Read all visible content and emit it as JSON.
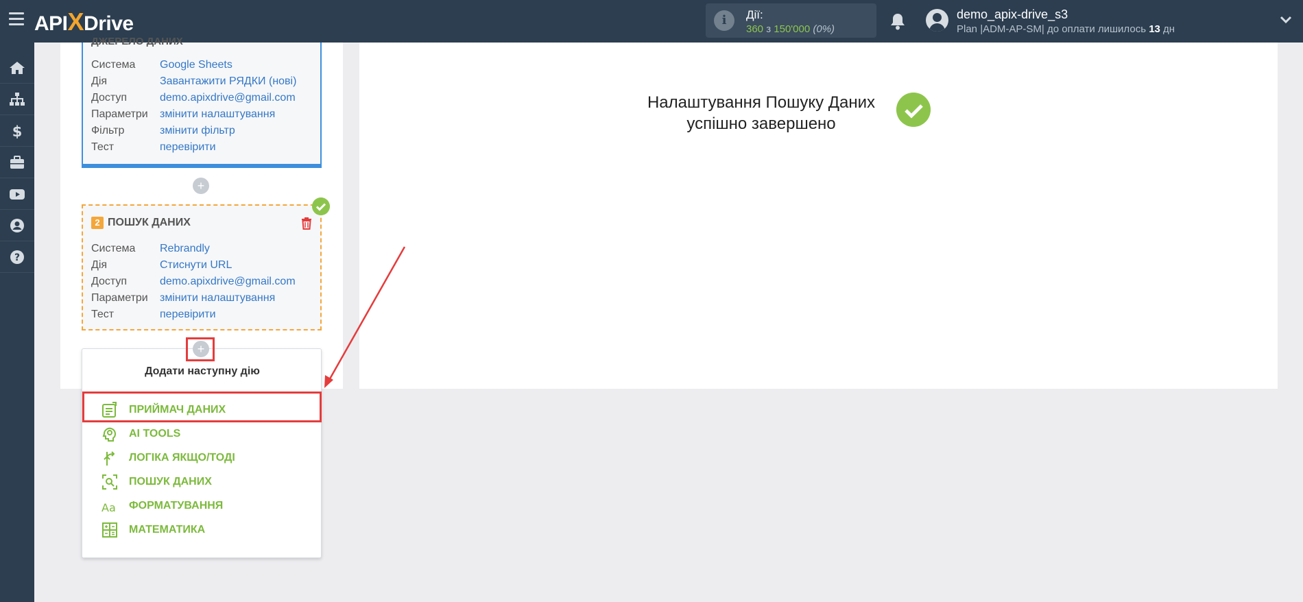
{
  "header": {
    "logo_left": "API",
    "logo_x": "X",
    "logo_right": "Drive",
    "actions_label": "Дії:",
    "actions_used": "360",
    "actions_sep": "з",
    "actions_total": "150'000",
    "actions_pct": "(0%)",
    "username": "demo_apix-drive_s3",
    "plan_text": "Plan |ADM-AP-SM| до оплати лишилось",
    "plan_days": "13",
    "plan_unit": "дн"
  },
  "sidebar": {
    "items": [
      "home-icon",
      "sitemap-icon",
      "dollar-icon",
      "briefcase-icon",
      "youtube-icon",
      "user-icon",
      "help-icon"
    ]
  },
  "block1": {
    "partial_title": "ДЖЕРЕЛО ДАНИХ",
    "rows": [
      {
        "k": "Система",
        "v": "Google Sheets"
      },
      {
        "k": "Дія",
        "v": "Завантажити РЯДКИ (нові)"
      },
      {
        "k": "Доступ",
        "v": "demo.apixdrive@gmail.com"
      },
      {
        "k": "Параметри",
        "v": "змінити налаштування"
      },
      {
        "k": "Фільтр",
        "v": "змінити фільтр"
      },
      {
        "k": "Тест",
        "v": "перевірити"
      }
    ]
  },
  "block2": {
    "number": "2",
    "title": "ПОШУК ДАНИХ",
    "rows": [
      {
        "k": "Система",
        "v": "Rebrandly"
      },
      {
        "k": "Дія",
        "v": "Стиснути URL"
      },
      {
        "k": "Доступ",
        "v": "demo.apixdrive@gmail.com"
      },
      {
        "k": "Параметри",
        "v": "змінити налаштування"
      },
      {
        "k": "Тест",
        "v": "перевірити"
      }
    ]
  },
  "plus_symbol": "+",
  "popup": {
    "title": "Додати наступну дію",
    "items": [
      {
        "label": "ПРИЙМАЧ ДАНИХ",
        "icon": "receiver-icon"
      },
      {
        "label": "AI TOOLS",
        "icon": "ai-head-icon"
      },
      {
        "label": "ЛОГІКА ЯКЩО/ТОДІ",
        "icon": "branch-icon"
      },
      {
        "label": "ПОШУК ДАНИХ",
        "icon": "search-data-icon"
      },
      {
        "label": "ФОРМАТУВАННЯ",
        "icon": "format-icon"
      },
      {
        "label": "МАТЕМАТИКА",
        "icon": "calculator-icon"
      }
    ]
  },
  "success": {
    "line1": "Налаштування Пошуку Даних",
    "line2": "успішно завершено"
  },
  "colors": {
    "topbar": "#2c3e50",
    "accent_green": "#7cba3c",
    "link_blue": "#3478c6",
    "highlight_red": "#e53c3c",
    "orange": "#f4a73a"
  }
}
